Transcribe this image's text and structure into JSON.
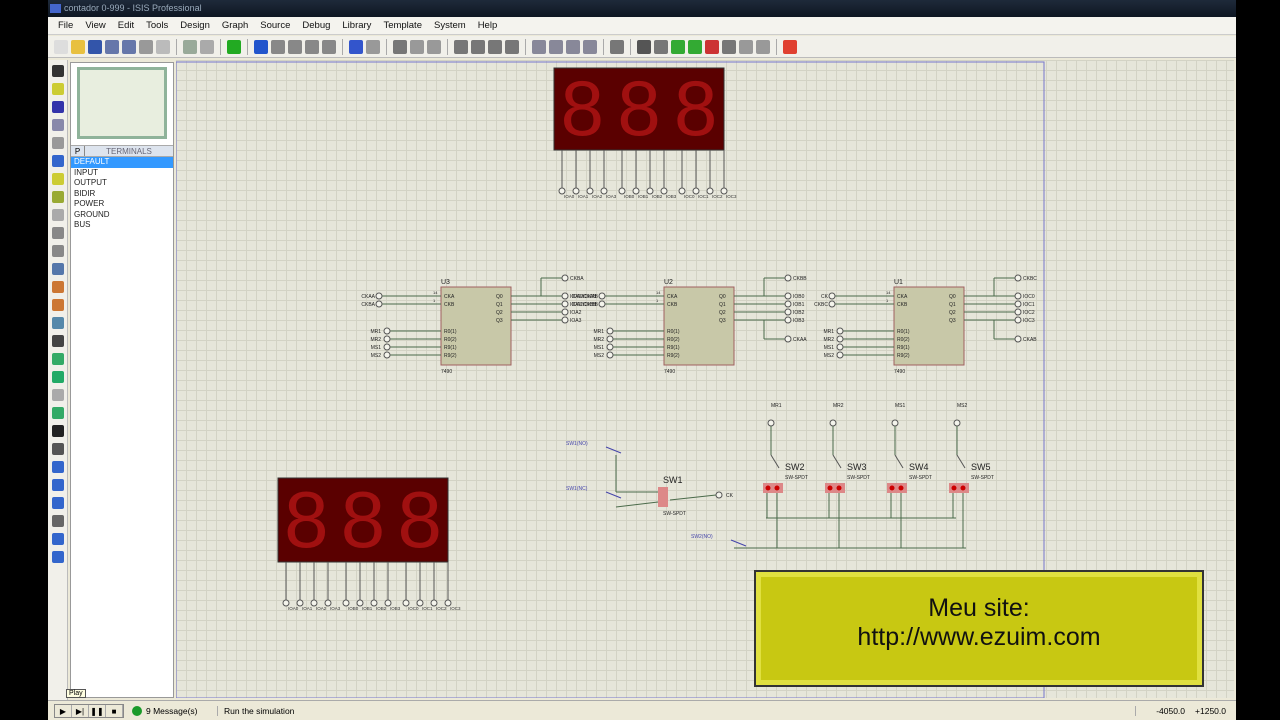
{
  "window": {
    "title": "contador 0-999 - ISIS Professional"
  },
  "menu": [
    "File",
    "View",
    "Edit",
    "Tools",
    "Design",
    "Graph",
    "Source",
    "Debug",
    "Library",
    "Template",
    "System",
    "Help"
  ],
  "panel": {
    "mode": "P",
    "header": "TERMINALS",
    "items": [
      "DEFAULT",
      "INPUT",
      "OUTPUT",
      "BIDIR",
      "POWER",
      "GROUND",
      "BUS"
    ],
    "selected": "DEFAULT"
  },
  "schematic": {
    "chips": [
      {
        "ref": "U3",
        "part": "7490",
        "inputs": [
          [
            "CKAA",
            "14"
          ],
          [
            "CKBA",
            "1"
          ]
        ],
        "outputs": [
          "IOA0/CKAB",
          "IOA1/CKBB",
          "IOA2",
          "IOA3"
        ],
        "top": "CKBA"
      },
      {
        "ref": "U2",
        "part": "7490",
        "inputs": [
          [
            "IOA0/CKAB",
            "14"
          ],
          [
            "IOA1/CKBB",
            "1"
          ]
        ],
        "outputs": [
          "IOB0",
          "IOB1",
          "IOB2",
          "IOB3"
        ],
        "top": "CKBB",
        "bottom": "CKAA"
      },
      {
        "ref": "U1",
        "part": "7490",
        "inputs": [
          [
            "CK",
            "14"
          ],
          [
            "CKBC",
            "1"
          ]
        ],
        "outputs": [
          "IOC0",
          "IOC1",
          "IOC2",
          "IOC3"
        ],
        "top": "CKBC",
        "bottom": "CKAB"
      }
    ],
    "chip_pins_in": [
      "CKA",
      "CKB"
    ],
    "chip_pins_out": [
      "Q0",
      "Q1",
      "Q2",
      "Q3"
    ],
    "chip_pins_reset": [
      "R0(1)",
      "R0(2)",
      "R9(1)",
      "R9(2)"
    ],
    "reset_nets": [
      "MR1",
      "MR2",
      "MS1",
      "MS2"
    ],
    "switches": [
      "SW2",
      "SW3",
      "SW4",
      "SW5"
    ],
    "switch_nets": [
      "MR1",
      "MR2",
      "MS1",
      "MS2"
    ],
    "switch_part": "SW-SPDT",
    "sw1": "SW1",
    "sw1_out": "CK",
    "pulse_labels": [
      "SW1(NO)",
      "SW1(NC)",
      "SW2(NO)"
    ],
    "display_top_pins": [
      "IOA0",
      "IOA1",
      "IOA2",
      "IOA3",
      "IOB0",
      "IOB1",
      "IOB2",
      "IOB3",
      "IOC0",
      "IOC1",
      "IOC2",
      "IOC3"
    ],
    "display_digits": "888",
    "segment_color": "#c00000"
  },
  "overlay": {
    "line1": "Meu site:",
    "line2": "http://www.ezuim.com"
  },
  "status": {
    "tooltip": "Play",
    "messages": "9 Message(s)",
    "hint": "Run the simulation",
    "x": "-4050.0",
    "y": "+1250.0"
  }
}
